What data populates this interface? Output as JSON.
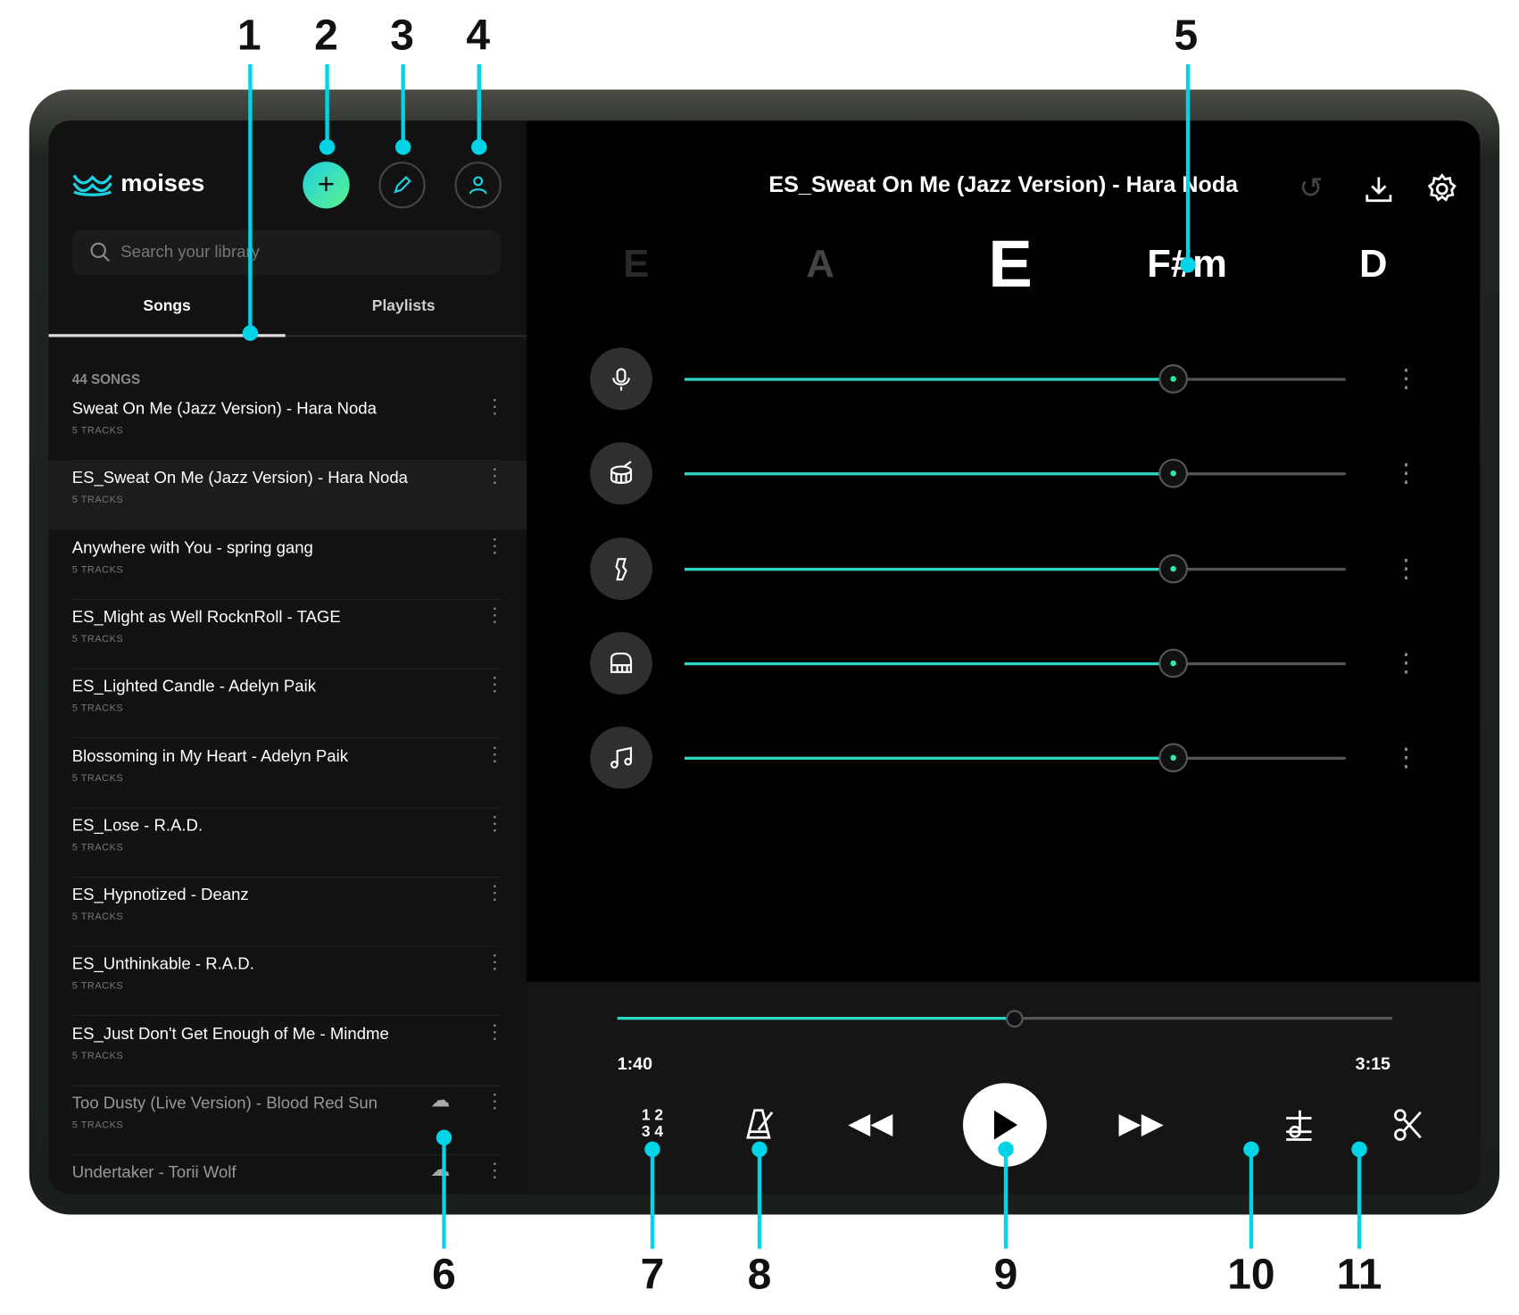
{
  "app": {
    "brand": "moises"
  },
  "sidebar": {
    "search_placeholder": "Search your library",
    "tabs": [
      {
        "label": "Songs",
        "active": true
      },
      {
        "label": "Playlists",
        "active": false
      }
    ],
    "count": "44 SONGS",
    "songs": [
      {
        "title": "Sweat On Me (Jazz Version) - Hara Noda",
        "tracks": "5 TRACKS"
      },
      {
        "title": "ES_Sweat On Me (Jazz Version) - Hara Noda",
        "tracks": "5 TRACKS",
        "selected": true
      },
      {
        "title": "Anywhere with You - spring gang",
        "tracks": "5 TRACKS"
      },
      {
        "title": "ES_Might as Well RocknRoll - TAGE",
        "tracks": "5 TRACKS"
      },
      {
        "title": "ES_Lighted Candle - Adelyn Paik",
        "tracks": "5 TRACKS"
      },
      {
        "title": "Blossoming in My Heart - Adelyn Paik",
        "tracks": "5 TRACKS"
      },
      {
        "title": "ES_Lose - R.A.D.",
        "tracks": "5 TRACKS"
      },
      {
        "title": "ES_Hypnotized - Deanz",
        "tracks": "5 TRACKS"
      },
      {
        "title": "ES_Unthinkable - R.A.D.",
        "tracks": "5 TRACKS"
      },
      {
        "title": "ES_Just Don't Get Enough of Me - Mindme",
        "tracks": "5 TRACKS"
      },
      {
        "title": "Too Dusty (Live Version) - Blood Red Sun",
        "tracks": "5 TRACKS",
        "cloud": true
      },
      {
        "title": "Undertaker - Torii Wolf",
        "tracks": "",
        "cloud": true
      }
    ]
  },
  "main": {
    "title": "ES_Sweat On Me (Jazz Version) - Hara Noda",
    "chords": [
      "E",
      "A",
      "E",
      "F#m",
      "D"
    ],
    "tracks": [
      {
        "icon": "microphone-icon",
        "volume": 0.74
      },
      {
        "icon": "drum-icon",
        "volume": 0.74
      },
      {
        "icon": "guitar-icon",
        "volume": 0.74
      },
      {
        "icon": "piano-icon",
        "volume": 0.74
      },
      {
        "icon": "music-note-icon",
        "volume": 0.74
      }
    ]
  },
  "player": {
    "current": "1:40",
    "duration": "3:15",
    "progress": 0.513
  },
  "annotations": [
    "1",
    "2",
    "3",
    "4",
    "5",
    "6",
    "7",
    "8",
    "9",
    "10",
    "11"
  ],
  "colors": {
    "accent": "#2ad6c0",
    "annotation": "#00d4e6"
  }
}
